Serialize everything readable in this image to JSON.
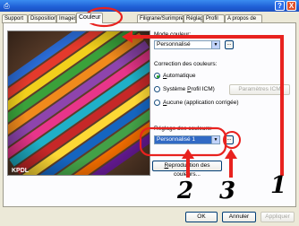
{
  "window": {
    "app_icon": "printer-icon",
    "help_glyph": "?",
    "close_glyph": "X"
  },
  "tabs": [
    {
      "label": "Support"
    },
    {
      "label": "Disposition"
    },
    {
      "label": "Images"
    },
    {
      "label": "Couleur"
    },
    {
      "label": "Filigrane/Surimpression"
    },
    {
      "label": "Réglage"
    },
    {
      "label": "Profil"
    },
    {
      "label": "A propos de"
    }
  ],
  "photo": {
    "label": "KPDL"
  },
  "color_mode": {
    "label": "Mode couleur:",
    "value": "Personnalisé",
    "more": "..."
  },
  "color_correction": {
    "label": "Correction des couleurs:",
    "options": [
      {
        "prefix": "",
        "underline": "A",
        "rest": "utomatique"
      },
      {
        "prefix": "Système ",
        "underline": "P",
        "rest": "rofil ICM)"
      },
      {
        "prefix": "",
        "underline": "A",
        "rest": "ucune (application corrigée)"
      }
    ],
    "icm_button": "Paramètres ICM"
  },
  "color_adjust": {
    "label": "Réglage des couleurs:",
    "value": "Personnalisé 1",
    "more": "..."
  },
  "reproduce_button": {
    "underline": "R",
    "rest": "eproduction des couleurs..."
  },
  "footer": {
    "ok": "OK",
    "cancel": "Annuler",
    "apply": "Appliquer"
  },
  "callouts": [
    "1",
    "2",
    "3"
  ],
  "colors": {
    "callout_red": "#e8221f",
    "accent_blue": "#316ac5"
  }
}
